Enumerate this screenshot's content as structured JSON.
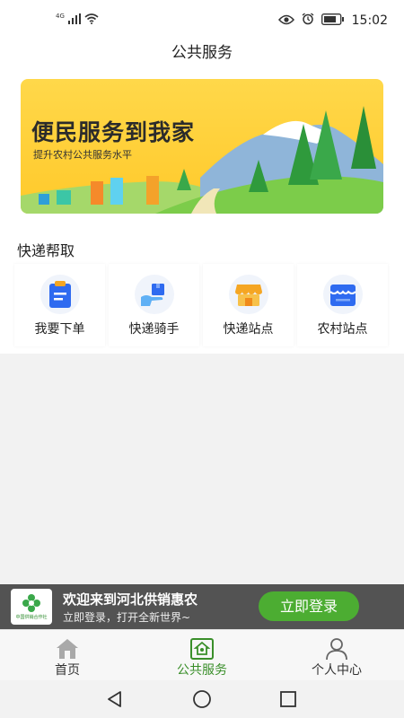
{
  "status_bar": {
    "network": "4G",
    "time": "15:02",
    "icons": [
      "signal-icon",
      "wifi-icon",
      "eye-icon",
      "alarm-icon",
      "battery-icon"
    ]
  },
  "page": {
    "title": "公共服务"
  },
  "banner": {
    "title": "便民服务到我家",
    "subtitle": "提升农村公共服务水平"
  },
  "express": {
    "section_title": "快递帮取",
    "items": [
      {
        "label": "我要下单",
        "icon": "clipboard-icon"
      },
      {
        "label": "快递骑手",
        "icon": "delivery-hand-icon"
      },
      {
        "label": "快递站点",
        "icon": "shop-icon"
      },
      {
        "label": "农村站点",
        "icon": "store-icon"
      }
    ]
  },
  "promo": {
    "title": "欢迎来到河北供销惠农",
    "subtitle": "立即登录，打开全新世界~",
    "login_label": "立即登录",
    "logo_text": "中国供销合作社"
  },
  "tabbar": {
    "tabs": [
      {
        "label": "首页",
        "icon": "home-icon"
      },
      {
        "label": "公共服务",
        "icon": "public-service-icon"
      },
      {
        "label": "个人中心",
        "icon": "person-icon"
      }
    ],
    "active_index": 1
  },
  "colors": {
    "accent": "#4cad32",
    "active_tab": "#3a8f2a",
    "banner_yellow": "#ffd23f",
    "icon_blue": "#2f6bf0",
    "icon_orange": "#f5a623"
  }
}
